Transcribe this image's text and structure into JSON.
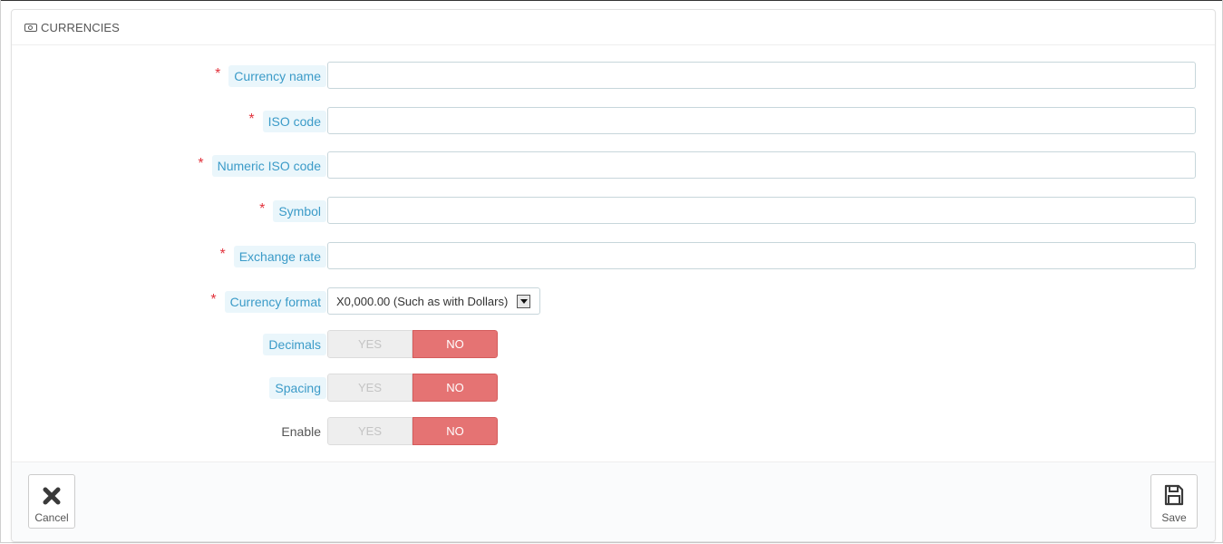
{
  "panel": {
    "title": "CURRENCIES",
    "title_icon": "money-icon"
  },
  "fields": [
    {
      "label": "Currency name",
      "required": true,
      "value": "",
      "type": "text"
    },
    {
      "label": "ISO code",
      "required": true,
      "value": "",
      "type": "text"
    },
    {
      "label": "Numeric ISO code",
      "required": true,
      "value": "",
      "type": "text"
    },
    {
      "label": "Symbol",
      "required": true,
      "value": "",
      "type": "text"
    },
    {
      "label": "Exchange rate",
      "required": true,
      "value": "",
      "type": "text"
    }
  ],
  "currency_format": {
    "label": "Currency format",
    "required": true,
    "selected": "X0,000.00 (Such as with Dollars)"
  },
  "toggles": [
    {
      "label": "Decimals",
      "yes": "YES",
      "no": "NO",
      "value": "NO"
    },
    {
      "label": "Spacing",
      "yes": "YES",
      "no": "NO",
      "value": "NO"
    },
    {
      "label": "Enable",
      "yes": "YES",
      "no": "NO",
      "value": "NO"
    }
  ],
  "footer": {
    "cancel_label": "Cancel",
    "save_label": "Save"
  },
  "colors": {
    "required_star": "#e2333d",
    "label_chip_bg": "#eaf6fb",
    "label_chip_text": "#3b9bc8",
    "toggle_no_active": "#e57373"
  },
  "required_mark": "*"
}
